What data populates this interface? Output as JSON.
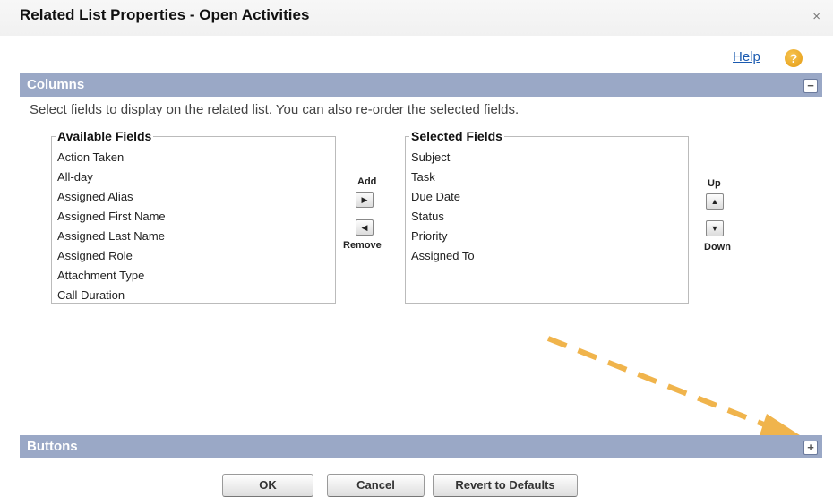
{
  "dialog": {
    "title": "Related List Properties - Open Activities",
    "close_glyph": "×"
  },
  "help": {
    "label": "Help",
    "icon_glyph": "?"
  },
  "columns_section": {
    "title": "Columns",
    "toggle_glyph": "−",
    "instructions": "Select fields to display on the related list. You can also re-order the selected fields.",
    "available_fields": {
      "label": "Available Fields",
      "items": [
        "Action Taken",
        "All-day",
        "Assigned Alias",
        "Assigned First Name",
        "Assigned Last Name",
        "Assigned Role",
        "Attachment Type",
        "Call Duration"
      ]
    },
    "selected_fields": {
      "label": "Selected Fields",
      "items": [
        "Subject",
        "Task",
        "Due Date",
        "Status",
        "Priority",
        "Assigned To"
      ]
    },
    "add_label": "Add",
    "remove_label": "Remove",
    "up_label": "Up",
    "down_label": "Down"
  },
  "buttons_section": {
    "title": "Buttons",
    "toggle_glyph": "+"
  },
  "footer": {
    "ok": "OK",
    "cancel": "Cancel",
    "revert": "Revert to Defaults"
  },
  "annotation": {
    "arrow_color": "#f0b44c"
  }
}
